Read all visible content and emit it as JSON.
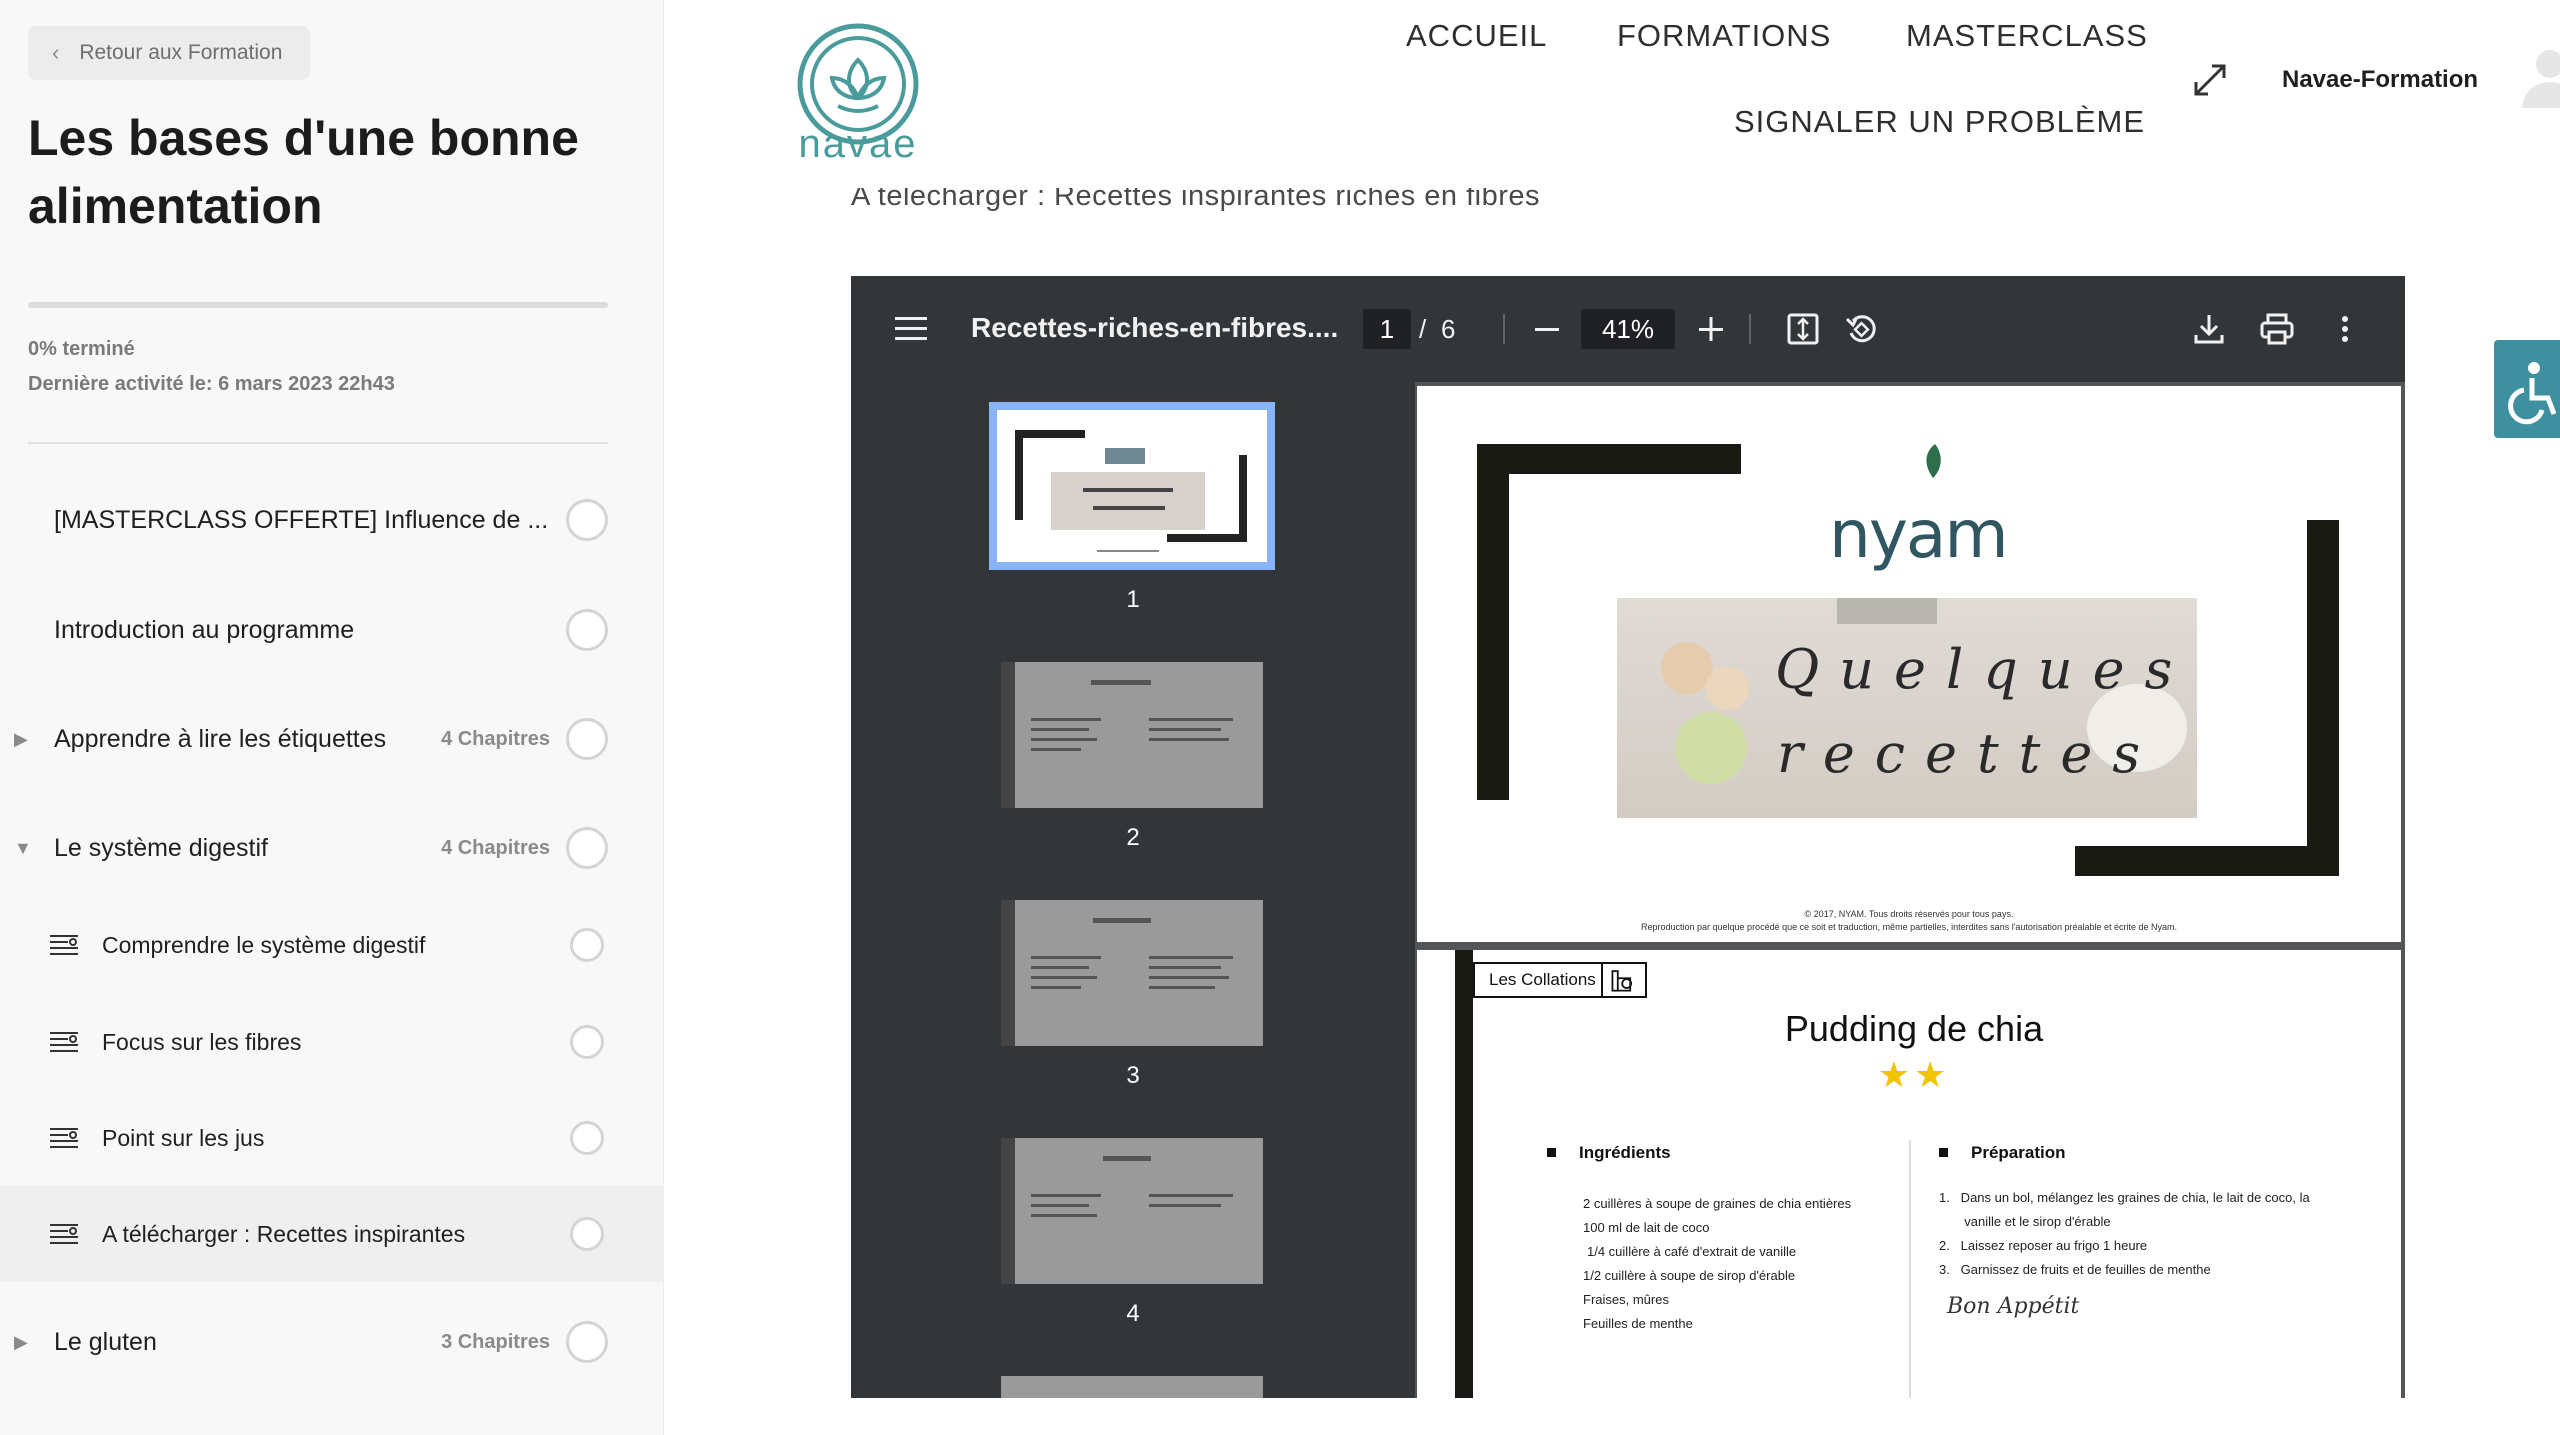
{
  "sidebar": {
    "back_label": "Retour aux Formation",
    "course_title": "Les bases d'une bonne alimentation",
    "progress_text": "0% terminé",
    "progress_fraction": 0.0,
    "last_activity": "Dernière activité le: 6 mars 2023 22h43",
    "items": [
      {
        "title": "[MASTERCLASS OFFERTE] Influence de ...",
        "chapters": ""
      },
      {
        "title": "Introduction au programme",
        "chapters": ""
      },
      {
        "title": "Apprendre à lire les étiquettes",
        "chapters": "4 Chapitres"
      },
      {
        "title": "Le système digestif",
        "chapters": "4 Chapitres"
      },
      {
        "title": "Comprendre le système digestif",
        "chapters": ""
      },
      {
        "title": "Focus sur les fibres",
        "chapters": ""
      },
      {
        "title": "Point sur les jus",
        "chapters": ""
      },
      {
        "title": "A télécharger : Recettes inspirantes",
        "chapters": ""
      },
      {
        "title": "Le gluten",
        "chapters": "3 Chapitres"
      }
    ]
  },
  "header": {
    "logo_text": "navae",
    "nav": [
      "ACCUEIL",
      "FORMATIONS",
      "MASTERCLASS",
      "SIGNALER UN PROBLÈME"
    ],
    "brand": "Navae-Formation"
  },
  "content": {
    "download_title": "A télécharger : Recettes inspirantes riches en fibres"
  },
  "viewer": {
    "filename": "Recettes-riches-en-fibres....",
    "page_current": "1",
    "page_sep": "/",
    "page_total": "6",
    "zoom": "41%",
    "thumbnail_numbers": [
      "1",
      "2",
      "3",
      "4"
    ]
  },
  "pdf_page1": {
    "brand": "nyam",
    "banner_line1": "Quelques",
    "banner_line2": "recettes",
    "copyright_line1": "© 2017, NYAM. Tous droits réservés pour tous pays.",
    "copyright_line2": "Reproduction par quelque procédé que ce soit et traduction, même partielles, interdites sans l'autorisation préalable et écrite de Nyam."
  },
  "pdf_page2": {
    "tag": "Les Collations",
    "title": "Pudding de chia",
    "stars": "★★",
    "ingredients_head": "Ingrédients",
    "ingredients": [
      "2 cuillères à soupe de graines de chia entières",
      "100 ml de lait de coco",
      "1/4 cuillère à café d'extrait de vanille",
      "1/2 cuillère à soupe de sirop d'érable",
      "Fraises, mûres",
      "Feuilles de menthe"
    ],
    "preparation_head": "Préparation",
    "steps": [
      "1.   Dans un bol, mélangez les graines de chia, le lait de coco, la",
      "       vanille et le sirop d'érable",
      "2.   Laissez reposer au frigo 1 heure",
      "3.   Garnissez de fruits et de feuilles de menthe"
    ],
    "sign_off": "Bon Appétit"
  },
  "colors": {
    "accent": "#4a9c9c",
    "viewer_toolbar": "#323639",
    "accessibility_button": "#3e8f9f"
  }
}
